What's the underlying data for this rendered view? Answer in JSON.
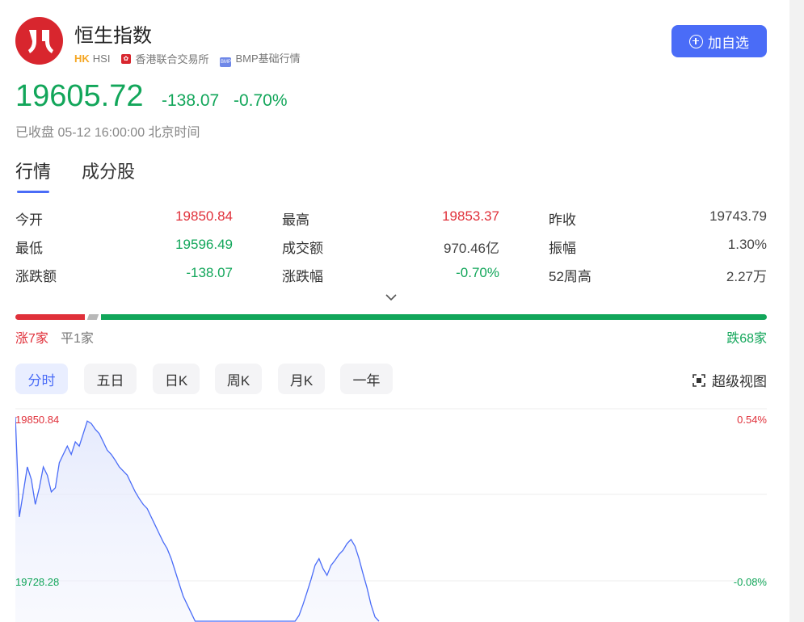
{
  "header": {
    "title": "恒生指数",
    "market": "HK",
    "symbol": "HSI",
    "exchange": "香港联合交易所",
    "bmp_icon_text": "BMP",
    "data_source": "BMP基础行情",
    "add_button": "加自选"
  },
  "quote": {
    "price": "19605.72",
    "change": "-138.07",
    "change_pct": "-0.70%",
    "status": "已收盘 05-12 16:00:00 北京时间"
  },
  "tabs": [
    "行情",
    "成分股"
  ],
  "stats": [
    {
      "label": "今开",
      "value": "19850.84",
      "color": "#e0303a"
    },
    {
      "label": "最高",
      "value": "19853.37",
      "color": "#e0303a"
    },
    {
      "label": "昨收",
      "value": "19743.79",
      "color": "#444444"
    },
    {
      "label": "最低",
      "value": "19596.49",
      "color": "#12a65a"
    },
    {
      "label": "成交额",
      "value": "970.46亿",
      "color": "#444444"
    },
    {
      "label": "振幅",
      "value": "1.30%",
      "color": "#444444"
    },
    {
      "label": "涨跌额",
      "value": "-138.07",
      "color": "#12a65a"
    },
    {
      "label": "涨跌幅",
      "value": "-0.70%",
      "color": "#12a65a"
    },
    {
      "label": "52周高",
      "value": "2.27万",
      "color": "#444444"
    }
  ],
  "advance_decline": {
    "up_text": "涨7家",
    "flat_text": "平1家",
    "down_text": "跌68家",
    "up_count": 7,
    "flat_count": 1,
    "down_count": 68
  },
  "periods": [
    "分时",
    "五日",
    "日K",
    "周K",
    "月K",
    "一年"
  ],
  "super_view": "超级视图",
  "colors": {
    "up": "#e0303a",
    "down": "#12a65a",
    "accent": "#4a6cf7",
    "line": "#4a6cf7"
  },
  "chart_data": {
    "type": "line",
    "y_left_labels": [
      "19850.84",
      "19728.28"
    ],
    "y_right_labels": [
      "0.54%",
      "-0.08%"
    ],
    "ylim": [
      19605,
      19851
    ],
    "x": [
      0,
      1,
      2,
      3,
      4,
      5,
      6,
      7,
      8,
      9,
      10,
      11,
      12,
      13,
      14,
      15,
      16,
      17,
      18,
      19,
      20,
      21,
      22,
      23,
      24,
      25,
      26,
      27,
      28,
      29,
      30,
      31,
      32,
      33,
      34,
      35,
      36,
      37,
      38,
      39,
      40,
      41,
      42,
      43,
      44,
      45,
      46,
      47,
      48,
      49,
      50,
      51,
      52,
      53,
      54,
      55,
      56,
      57,
      58,
      59,
      60,
      61,
      62,
      63,
      64,
      65,
      66,
      67,
      68,
      69,
      70,
      71,
      72,
      73,
      74,
      75,
      76,
      77,
      78,
      79,
      80,
      81,
      82,
      83,
      84,
      85,
      86,
      87,
      88,
      89,
      90,
      91
    ],
    "values": [
      19850,
      19730,
      19760,
      19790,
      19775,
      19745,
      19765,
      19790,
      19780,
      19760,
      19765,
      19795,
      19805,
      19815,
      19805,
      19820,
      19815,
      19830,
      19845,
      19842,
      19835,
      19830,
      19820,
      19810,
      19805,
      19798,
      19790,
      19785,
      19780,
      19770,
      19760,
      19752,
      19745,
      19740,
      19730,
      19720,
      19710,
      19700,
      19692,
      19680,
      19665,
      19650,
      19635,
      19625,
      19615,
      19605,
      19605,
      19605,
      19605,
      19605,
      19605,
      19605,
      19605,
      19605,
      19605,
      19605,
      19605,
      19605,
      19605,
      19605,
      19605,
      19605,
      19605,
      19605,
      19605,
      19605,
      19605,
      19605,
      19605,
      19605,
      19605,
      19612,
      19625,
      19640,
      19655,
      19672,
      19680,
      19668,
      19660,
      19672,
      19678,
      19685,
      19690,
      19698,
      19703,
      19695,
      19680,
      19662,
      19645,
      19625,
      19610,
      19605
    ]
  }
}
